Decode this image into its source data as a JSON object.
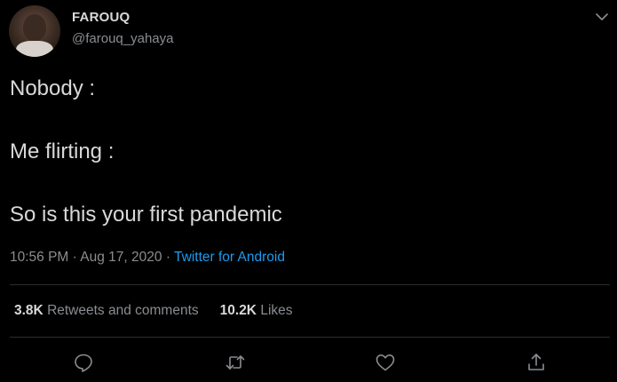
{
  "author": {
    "display_name": "FAROUQ",
    "handle": "@farouq_yahaya"
  },
  "tweet": {
    "lines": [
      "Nobody :",
      "Me flirting :",
      "So is this your first pandemic"
    ],
    "time": "10:56 PM",
    "date": "Aug 17, 2020",
    "source": "Twitter for Android",
    "separator": "·"
  },
  "stats": {
    "retweets_count": "3.8K",
    "retweets_label": "Retweets and comments",
    "likes_count": "10.2K",
    "likes_label": "Likes"
  },
  "icons": {
    "menu": "chevron-down-icon",
    "reply": "reply-icon",
    "retweet": "retweet-icon",
    "like": "heart-icon",
    "share": "share-icon"
  },
  "colors": {
    "background": "#000000",
    "text": "#d9d9d9",
    "secondary": "#8a8d91",
    "link": "#1d9bf0"
  }
}
